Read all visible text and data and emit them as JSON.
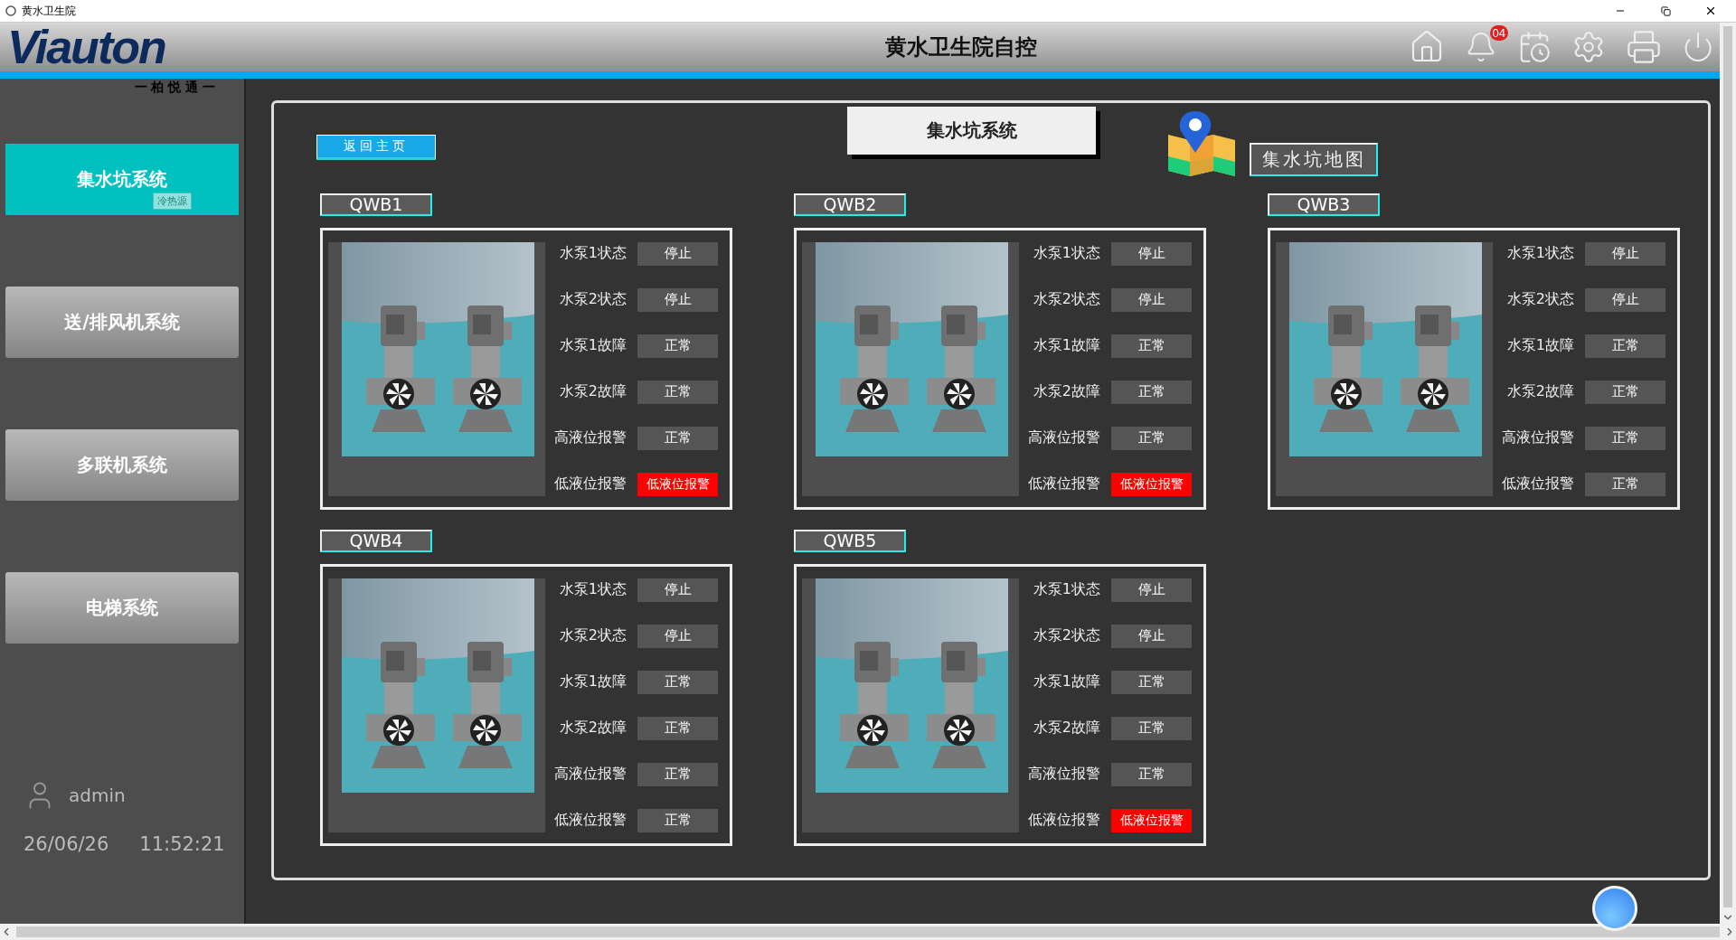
{
  "window": {
    "title": "黄水卫生院"
  },
  "header": {
    "logo": "Viauton",
    "logo_subtitle": "一 柏 悦 通 一",
    "title": "黄水卫生院自控",
    "notification_count": "04"
  },
  "sidebar": {
    "items": [
      {
        "label": "集水坑系统",
        "selected": true,
        "tag": "冷热源"
      },
      {
        "label": "送/排风机系统",
        "selected": false
      },
      {
        "label": "多联机系统",
        "selected": false
      },
      {
        "label": "电梯系统",
        "selected": false
      }
    ],
    "user": "admin",
    "date": "26/06/26",
    "time": "11:52:21"
  },
  "panel": {
    "back_button": "返回主页",
    "title": "集水坑系统",
    "map_button": "集水坑地图",
    "pits": [
      {
        "name": "QWB1",
        "rows": [
          {
            "label": "水泵1状态",
            "value": "停止",
            "alarm": false
          },
          {
            "label": "水泵2状态",
            "value": "停止",
            "alarm": false
          },
          {
            "label": "水泵1故障",
            "value": "正常",
            "alarm": false
          },
          {
            "label": "水泵2故障",
            "value": "正常",
            "alarm": false
          },
          {
            "label": "高液位报警",
            "value": "正常",
            "alarm": false
          },
          {
            "label": "低液位报警",
            "value": "低液位报警",
            "alarm": true
          }
        ]
      },
      {
        "name": "QWB2",
        "rows": [
          {
            "label": "水泵1状态",
            "value": "停止",
            "alarm": false
          },
          {
            "label": "水泵2状态",
            "value": "停止",
            "alarm": false
          },
          {
            "label": "水泵1故障",
            "value": "正常",
            "alarm": false
          },
          {
            "label": "水泵2故障",
            "value": "正常",
            "alarm": false
          },
          {
            "label": "高液位报警",
            "value": "正常",
            "alarm": false
          },
          {
            "label": "低液位报警",
            "value": "低液位报警",
            "alarm": true
          }
        ]
      },
      {
        "name": "QWB3",
        "rows": [
          {
            "label": "水泵1状态",
            "value": "停止",
            "alarm": false
          },
          {
            "label": "水泵2状态",
            "value": "停止",
            "alarm": false
          },
          {
            "label": "水泵1故障",
            "value": "正常",
            "alarm": false
          },
          {
            "label": "水泵2故障",
            "value": "正常",
            "alarm": false
          },
          {
            "label": "高液位报警",
            "value": "正常",
            "alarm": false
          },
          {
            "label": "低液位报警",
            "value": "正常",
            "alarm": false
          }
        ]
      },
      {
        "name": "QWB4",
        "rows": [
          {
            "label": "水泵1状态",
            "value": "停止",
            "alarm": false
          },
          {
            "label": "水泵2状态",
            "value": "停止",
            "alarm": false
          },
          {
            "label": "水泵1故障",
            "value": "正常",
            "alarm": false
          },
          {
            "label": "水泵2故障",
            "value": "正常",
            "alarm": false
          },
          {
            "label": "高液位报警",
            "value": "正常",
            "alarm": false
          },
          {
            "label": "低液位报警",
            "value": "正常",
            "alarm": false
          }
        ]
      },
      {
        "name": "QWB5",
        "rows": [
          {
            "label": "水泵1状态",
            "value": "停止",
            "alarm": false
          },
          {
            "label": "水泵2状态",
            "value": "停止",
            "alarm": false
          },
          {
            "label": "水泵1故障",
            "value": "正常",
            "alarm": false
          },
          {
            "label": "水泵2故障",
            "value": "正常",
            "alarm": false
          },
          {
            "label": "高液位报警",
            "value": "正常",
            "alarm": false
          },
          {
            "label": "低液位报警",
            "value": "低液位报警",
            "alarm": true
          }
        ]
      }
    ]
  }
}
